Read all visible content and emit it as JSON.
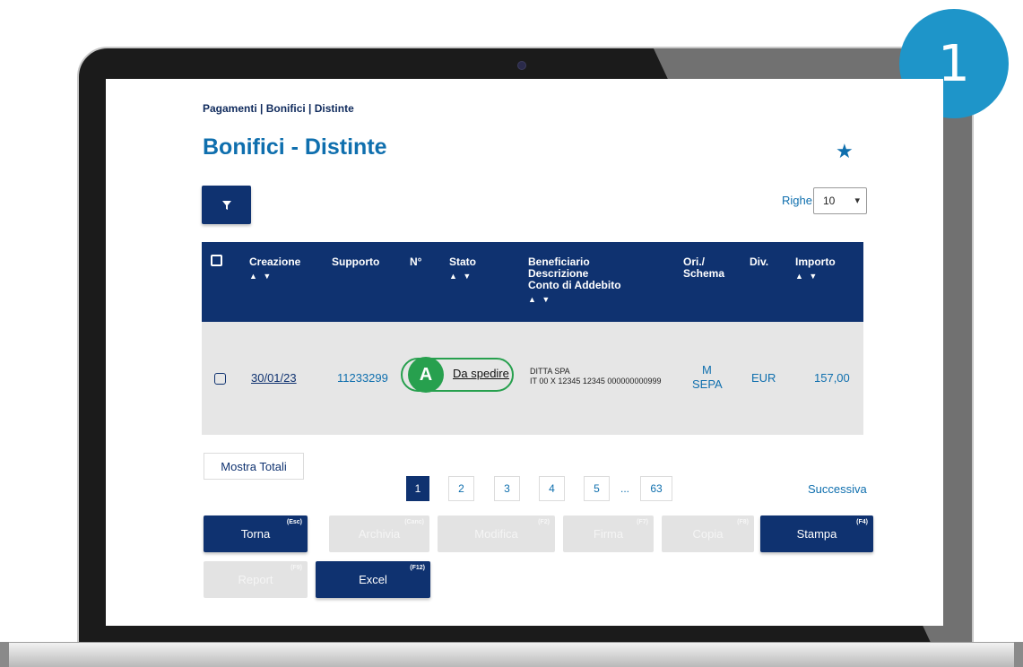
{
  "step_badge": "1",
  "breadcrumb": "Pagamenti | Bonifici | Distinte",
  "title": "Bonifici - Distinte",
  "rows_label": "Righe",
  "rows_value": "10",
  "headers": {
    "creazione": "Creazione",
    "supporto": "Supporto",
    "numero": "N°",
    "stato": "Stato",
    "beneficiario": "Beneficiario",
    "descrizione": "Descrizione",
    "conto": "Conto di Addebito",
    "ori": "Ori./",
    "schema": "Schema",
    "div": "Div.",
    "importo": "Importo",
    "sort": "▲ ▼"
  },
  "row": {
    "data": "30/01/23",
    "supporto": "11233299",
    "annotation": "A",
    "stato": "Da spedire",
    "beneficiario": "DITTA SPA",
    "conto": "IT 00 X 12345 12345 000000000999",
    "ori": "M",
    "schema": "SEPA",
    "div": "EUR",
    "importo": "157,00"
  },
  "mostra_totali": "Mostra Totali",
  "pagination": {
    "p1": "1",
    "p2": "2",
    "p3": "3",
    "p4": "4",
    "p5": "5",
    "dots": "...",
    "last": "63",
    "next": "Successiva"
  },
  "buttons": {
    "torna": {
      "label": "Torna",
      "key": "(Esc)"
    },
    "archivia": {
      "label": "Archivia",
      "key": "(Canc)"
    },
    "modifica": {
      "label": "Modifica",
      "key": "(F2)"
    },
    "firma": {
      "label": "Firma",
      "key": "(F7)"
    },
    "copia": {
      "label": "Copia",
      "key": "(F8)"
    },
    "stampa": {
      "label": "Stampa",
      "key": "(F4)"
    },
    "report": {
      "label": "Report",
      "key": "(F9)"
    },
    "excel": {
      "label": "Excel",
      "key": "(F12)"
    }
  },
  "colors": {
    "navy": "#0f3270",
    "title_blue": "#0f6fae",
    "annotation_green": "#27a04e",
    "badge_blue": "#1e95c9"
  }
}
